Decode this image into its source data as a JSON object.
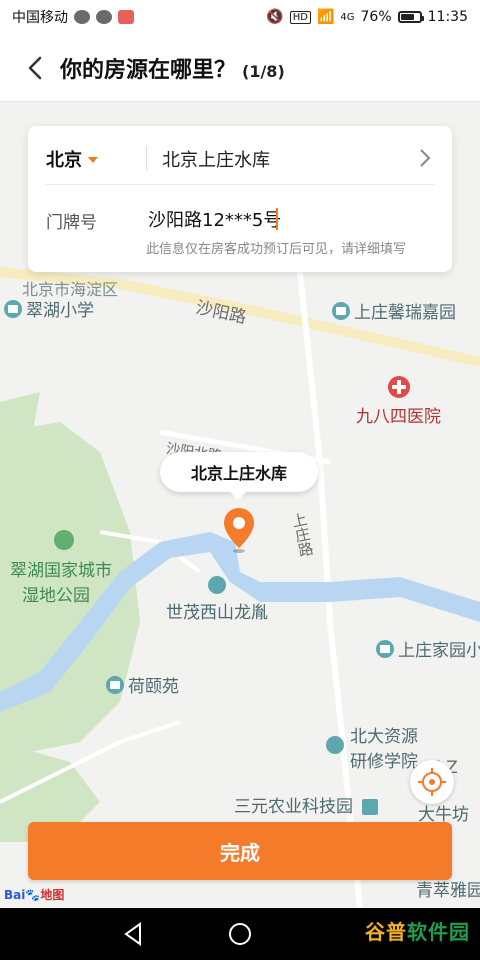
{
  "status_bar": {
    "carrier": "中国移动",
    "signal_text": "4G",
    "battery_percent": 76,
    "battery_text": "76%",
    "time": "11:35"
  },
  "header": {
    "title": "你的房源在哪里？",
    "step": "(1/8)"
  },
  "form": {
    "city": "北京",
    "address": "北京上庄水库",
    "door_label": "门牌号",
    "door_value": "沙阳路12***5号",
    "hint": "此信息仅在房客成功预订后可见，请详细填写"
  },
  "map": {
    "pin_label": "北京上庄水库",
    "labels": {
      "haidian": "北京市海淀区",
      "cuihu_school": "翠湖小学",
      "shayang_road": "沙阳路",
      "shangzhuang_garden": "上庄馨瑞嘉园",
      "hospital": "九八四医院",
      "shayang_north": "沙阳北路",
      "shangzhuang_road": "上庄路",
      "wetland_1": "翠湖国家城市",
      "wetland_2": "湿地公园",
      "shimao": "世茂西山龙胤",
      "shangzhuang_home": "上庄家园小",
      "heyiyuan": "荷颐苑",
      "pku_1": "北大资源",
      "pku_2": "研修学院",
      "edge": "E Z",
      "sanyuan": "三元农业科技园",
      "daniu": "大牛坊",
      "qingcui": "青萃雅园"
    }
  },
  "actions": {
    "done_label": "完成"
  },
  "branding": {
    "baidu": "Bai",
    "baidu_map": "地图",
    "watermark_a": "谷普",
    "watermark_b": "软件园"
  },
  "colors": {
    "accent": "#f37b2a",
    "water": "#b8d6f2",
    "park": "#cfe5c4"
  }
}
